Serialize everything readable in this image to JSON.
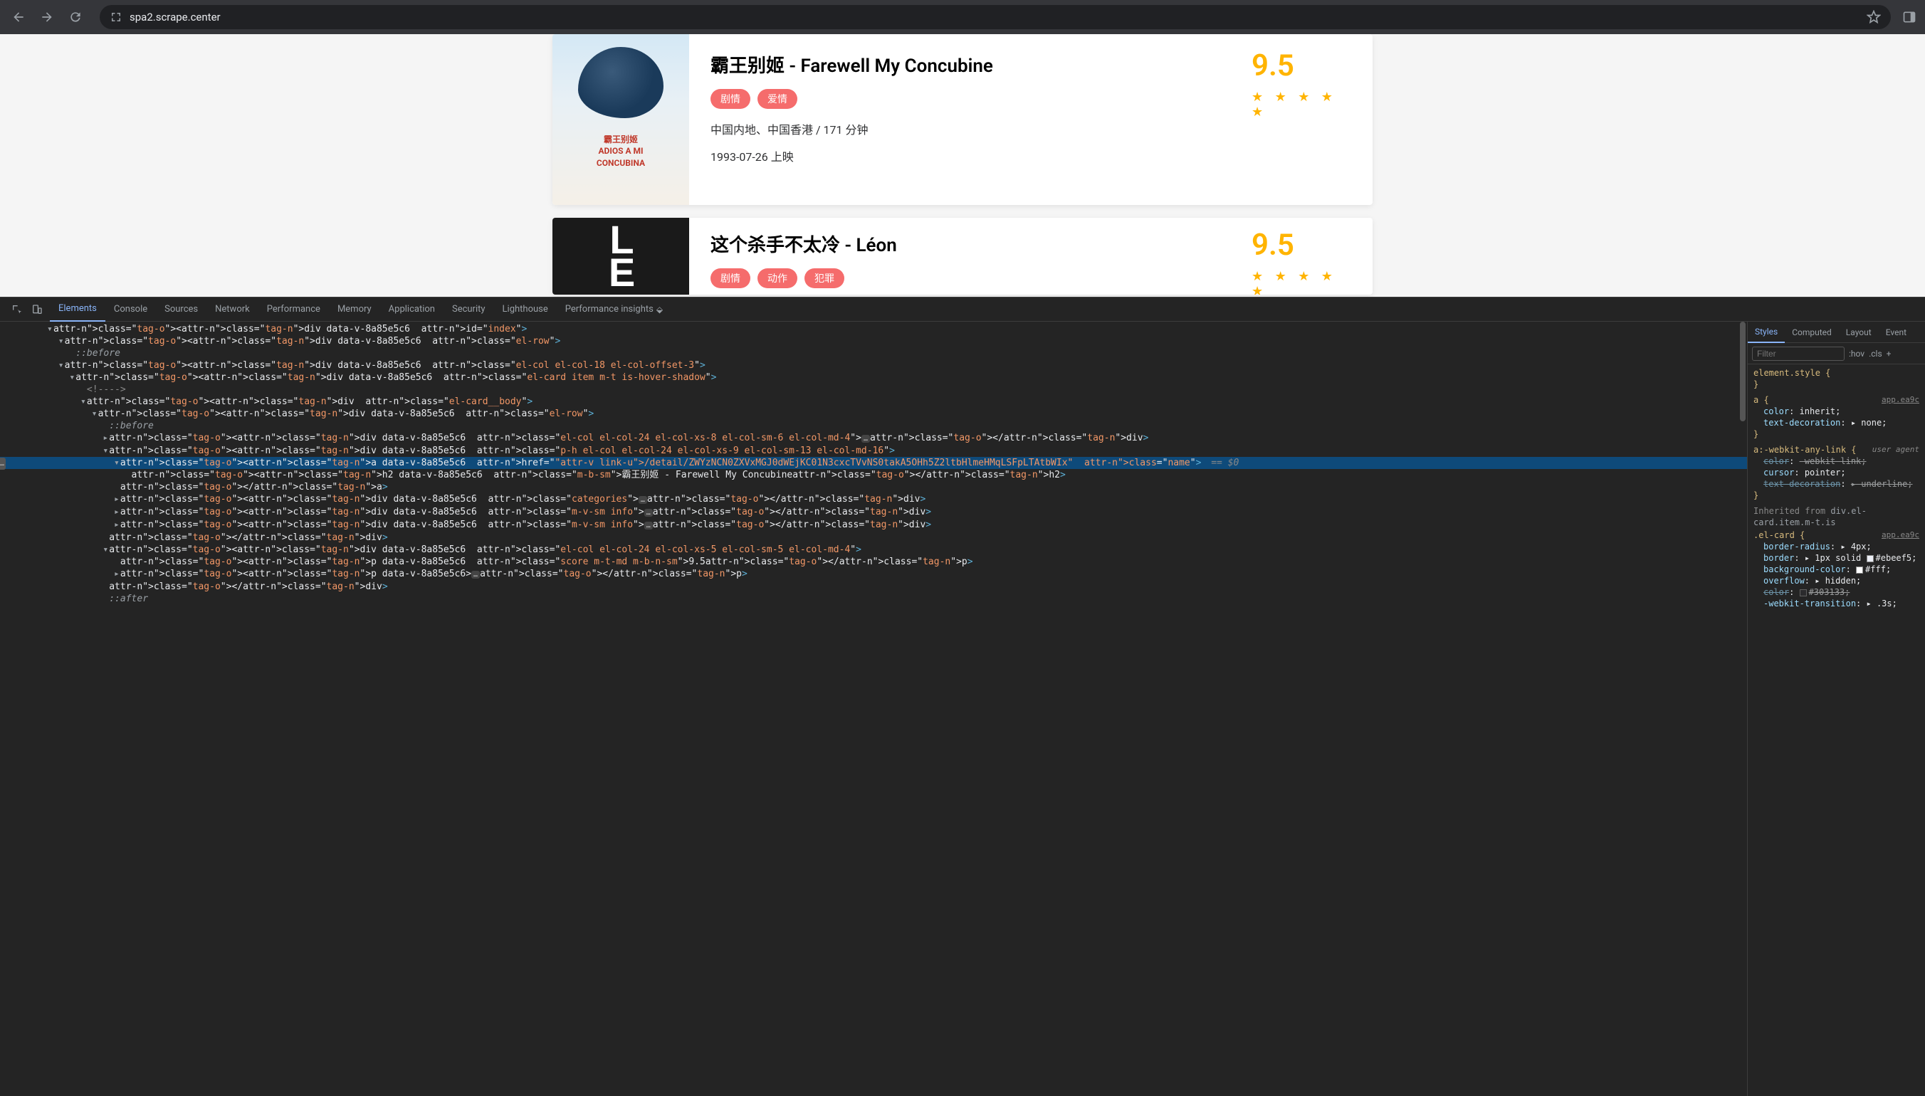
{
  "browser": {
    "url": "spa2.scrape.center"
  },
  "movies": [
    {
      "title": "霸王别姬 - Farewell My Concubine",
      "tags": [
        "剧情",
        "爱情"
      ],
      "region_runtime": "中国内地、中国香港 / 171 分钟",
      "release": "1993-07-26 上映",
      "score": "9.5"
    },
    {
      "title": "这个杀手不太冷 - Léon",
      "tags": [
        "剧情",
        "动作",
        "犯罪"
      ],
      "region_runtime": "",
      "release": "",
      "score": "9.5"
    }
  ],
  "devtools": {
    "tabs": [
      "Elements",
      "Console",
      "Sources",
      "Network",
      "Performance",
      "Memory",
      "Application",
      "Security",
      "Lighthouse",
      "Performance insights"
    ],
    "active_tab": "Elements",
    "dom_lines": [
      {
        "indent": 3,
        "tw": "▾",
        "html": "<div data-v-8a85e5c6 id=\"index\">",
        "cls": ""
      },
      {
        "indent": 4,
        "tw": "▾",
        "html": "<div data-v-8a85e5c6 class=\"el-row\">",
        "cls": ""
      },
      {
        "indent": 5,
        "tw": "",
        "html": "::before",
        "cls": "pseudo"
      },
      {
        "indent": 4,
        "tw": "▾",
        "html": "<div data-v-8a85e5c6 class=\"el-col el-col-18 el-col-offset-3\">",
        "cls": ""
      },
      {
        "indent": 5,
        "tw": "▾",
        "html": "<div data-v-8a85e5c6 class=\"el-card item m-t is-hover-shadow\">",
        "cls": ""
      },
      {
        "indent": 6,
        "tw": "",
        "html": "<!---->",
        "cls": "comm"
      },
      {
        "indent": 6,
        "tw": "▾",
        "html": "<div class=\"el-card__body\">",
        "cls": ""
      },
      {
        "indent": 7,
        "tw": "▾",
        "html": "<div data-v-8a85e5c6 class=\"el-row\">",
        "cls": ""
      },
      {
        "indent": 8,
        "tw": "",
        "html": "::before",
        "cls": "pseudo"
      },
      {
        "indent": 8,
        "tw": "▸",
        "html": "<div data-v-8a85e5c6 class=\"el-col el-col-24 el-col-xs-8 el-col-sm-6 el-col-md-4\">…</div>",
        "cls": ""
      },
      {
        "indent": 8,
        "tw": "▾",
        "html": "<div data-v-8a85e5c6 class=\"p-h el-col el-col-24 el-col-xs-9 el-col-sm-13 el-col-md-16\">",
        "cls": ""
      },
      {
        "indent": 9,
        "tw": "▾",
        "html": "<a data-v-8a85e5c6 href=\"/detail/ZWYzNCN0ZXVxMGJ0dWEjKC01N3cxcTVvNS0takA5OHh5Z2ltbHlmeHMqLSFpLTAtbWIx\" class=\"name\">",
        "cls": "sel",
        "eq": " == $0"
      },
      {
        "indent": 10,
        "tw": "",
        "html": "<h2 data-v-8a85e5c6 class=\"m-b-sm\">霸王别姬 - Farewell My Concubine</h2>",
        "cls": ""
      },
      {
        "indent": 9,
        "tw": "",
        "html": "</a>",
        "cls": ""
      },
      {
        "indent": 9,
        "tw": "▸",
        "html": "<div data-v-8a85e5c6 class=\"categories\">…</div>",
        "cls": ""
      },
      {
        "indent": 9,
        "tw": "▸",
        "html": "<div data-v-8a85e5c6 class=\"m-v-sm info\">…</div>",
        "cls": ""
      },
      {
        "indent": 9,
        "tw": "▸",
        "html": "<div data-v-8a85e5c6 class=\"m-v-sm info\">…</div>",
        "cls": ""
      },
      {
        "indent": 8,
        "tw": "",
        "html": "</div>",
        "cls": ""
      },
      {
        "indent": 8,
        "tw": "▾",
        "html": "<div data-v-8a85e5c6 class=\"el-col el-col-24 el-col-xs-5 el-col-sm-5 el-col-md-4\">",
        "cls": ""
      },
      {
        "indent": 9,
        "tw": "",
        "html": "<p data-v-8a85e5c6 class=\"score m-t-md m-b-n-sm\">9.5</p>",
        "cls": ""
      },
      {
        "indent": 9,
        "tw": "▸",
        "html": "<p data-v-8a85e5c6>…</p>",
        "cls": ""
      },
      {
        "indent": 8,
        "tw": "",
        "html": "</div>",
        "cls": ""
      },
      {
        "indent": 8,
        "tw": "",
        "html": "::after",
        "cls": "pseudo"
      }
    ],
    "styles": {
      "tabs": [
        "Styles",
        "Computed",
        "Layout",
        "Event"
      ],
      "active": "Styles",
      "filter_ph": "Filter",
      "toolbar": [
        ":hov",
        ".cls",
        "+"
      ],
      "rules": [
        {
          "sel": "element.style {",
          "src": "",
          "props": [],
          "close": "}"
        },
        {
          "sel": "a {",
          "src": "app.ea9c",
          "props": [
            {
              "k": "color",
              "v": "inherit"
            },
            {
              "k": "text-decoration",
              "v": "▸ none",
              "tw": true
            }
          ],
          "close": "}"
        },
        {
          "sel": "a:-webkit-any-link {",
          "ua": "user agent",
          "props": [
            {
              "k": "color",
              "v": "-webkit-link",
              "strike": true
            },
            {
              "k": "cursor",
              "v": "pointer"
            },
            {
              "k": "text-decoration",
              "v": "▸ underline",
              "strike": true,
              "tw": true
            }
          ],
          "close": "}"
        },
        {
          "inherit": "div.el-card.item.m-t.is"
        },
        {
          "sel": ".el-card {",
          "src": "app.ea9c",
          "props": [
            {
              "k": "border-radius",
              "v": "▸ 4px",
              "tw": true
            },
            {
              "k": "border",
              "v": "▸ 1px solid",
              "swatch": "#ebeef5",
              "sv": "#ebeef5",
              "tw": true
            },
            {
              "k": "background-color",
              "v": "",
              "swatch": "#fff",
              "sv": "#fff"
            },
            {
              "k": "overflow",
              "v": "▸ hidden",
              "tw": true
            },
            {
              "k": "color",
              "v": "",
              "swatch": "#303133",
              "sv": "#303133",
              "strike": true
            },
            {
              "k": "-webkit-transition",
              "v": "▸ .3s",
              "tw": true
            }
          ],
          "close": ""
        }
      ]
    }
  }
}
